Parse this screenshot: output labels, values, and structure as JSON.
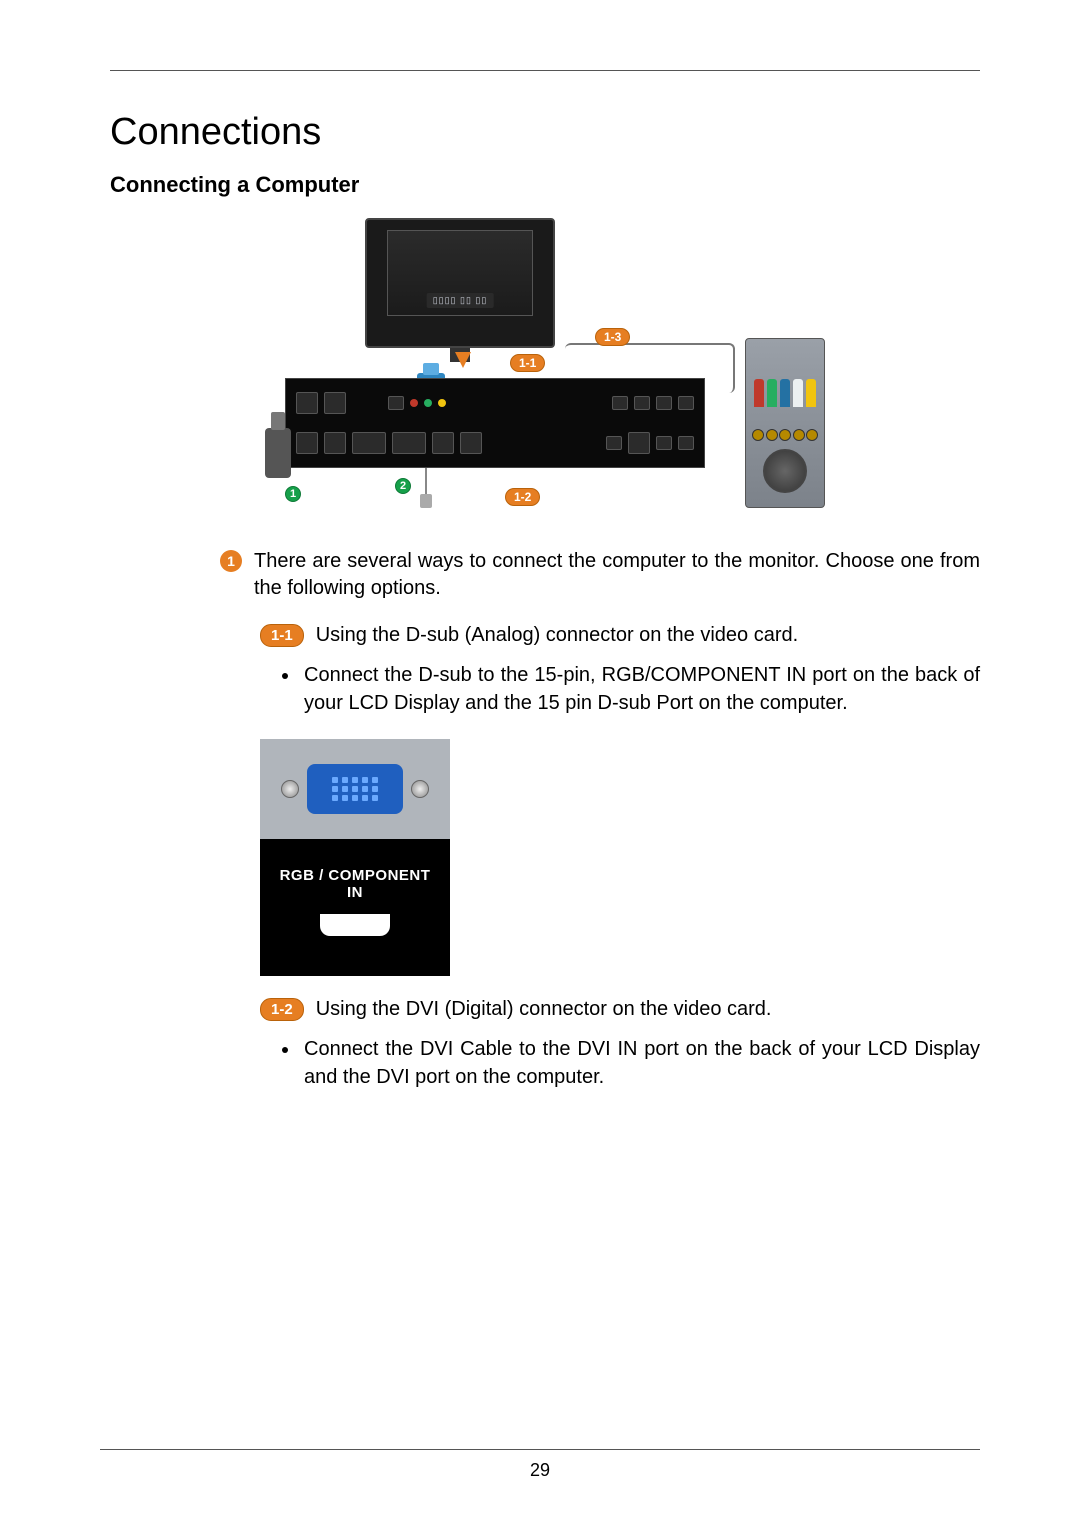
{
  "title": "Connections",
  "subtitle": "Connecting a Computer",
  "diagram": {
    "monitor_osd": "▯▯▯▯ ▯▯ ▯▯",
    "callouts": {
      "c1": "1",
      "c2": "2",
      "c11": "1-1",
      "c12": "1-2",
      "c13": "1-3"
    }
  },
  "step1": {
    "num": "1",
    "text": "There are several ways to connect the computer to the monitor. Choose one from the following options."
  },
  "sub11": {
    "pill": "1-1",
    "text": "Using the D-sub (Analog) connector on the video card.",
    "bullet": "Connect the D-sub to the 15-pin, RGB/COMPONENT IN port on the back of your LCD Display and the 15 pin D-sub Port on the computer."
  },
  "closeup_label_line1": "RGB / COMPONENT",
  "closeup_label_line2": "IN",
  "sub12": {
    "pill": "1-2",
    "text": "Using the DVI (Digital) connector on the video card.",
    "bullet": "Connect the DVI Cable to the DVI IN port on the back of your LCD Display and the DVI port on the computer."
  },
  "page_number": "29"
}
